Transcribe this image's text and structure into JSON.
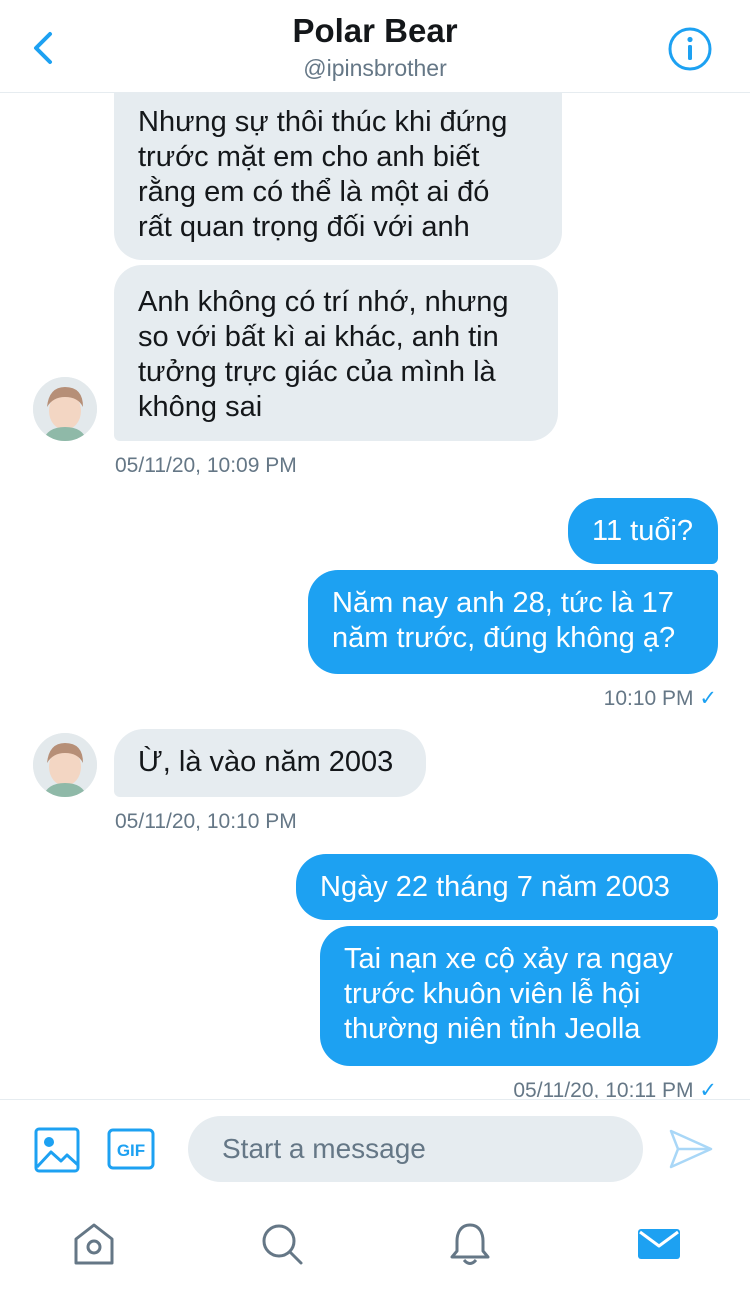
{
  "header": {
    "title": "Polar Bear",
    "handle": "@ipinsbrother",
    "back_icon": "chevron-left-icon",
    "info_icon": "info-icon"
  },
  "messages": [
    {
      "side": "in",
      "text": "Nhưng sự thôi thúc khi đứng\ntrước mặt em cho anh biết\nrằng em có thể là một ai đó\nrất quan trọng đối với anh"
    },
    {
      "side": "in",
      "text": "Anh không có trí nhớ, nhưng\nso với bất kì ai khác, anh tin\ntưởng trực giác của mình là\nkhông sai"
    },
    {
      "side": "in",
      "timestamp": "05/11/20, 10:09 PM"
    },
    {
      "side": "out",
      "text": "11 tuổi?"
    },
    {
      "side": "out",
      "text": "Năm nay anh 28, tức là 17\nnăm trước, đúng không ạ?"
    },
    {
      "side": "out",
      "timestamp": "10:10 PM",
      "status": "✓"
    },
    {
      "side": "in",
      "text": "Ừ, là vào năm 2003"
    },
    {
      "side": "in",
      "timestamp": "05/11/20, 10:10 PM"
    },
    {
      "side": "out",
      "text": "Ngày 22 tháng 7 năm 2003"
    },
    {
      "side": "out",
      "text": "Tai nạn xe cộ xảy ra ngay\ntrước khuôn viên lễ hội\nthường niên tỉnh Jeolla"
    },
    {
      "side": "out",
      "timestamp": "05/11/20, 10:11 PM",
      "status": "✓"
    }
  ],
  "composer": {
    "placeholder": "Start a message",
    "value": "",
    "media_icon": "image-icon",
    "gif_label": "GIF",
    "send_icon": "send-icon"
  },
  "tabs": [
    {
      "name": "home",
      "icon": "home-icon",
      "active": false
    },
    {
      "name": "search",
      "icon": "search-icon",
      "active": false
    },
    {
      "name": "notifications",
      "icon": "bell-icon",
      "active": false
    },
    {
      "name": "messages",
      "icon": "mail-icon",
      "active": true
    }
  ],
  "colors": {
    "accent": "#1da1f2",
    "incoming_bubble": "#e6ecf0",
    "secondary_text": "#657786"
  }
}
